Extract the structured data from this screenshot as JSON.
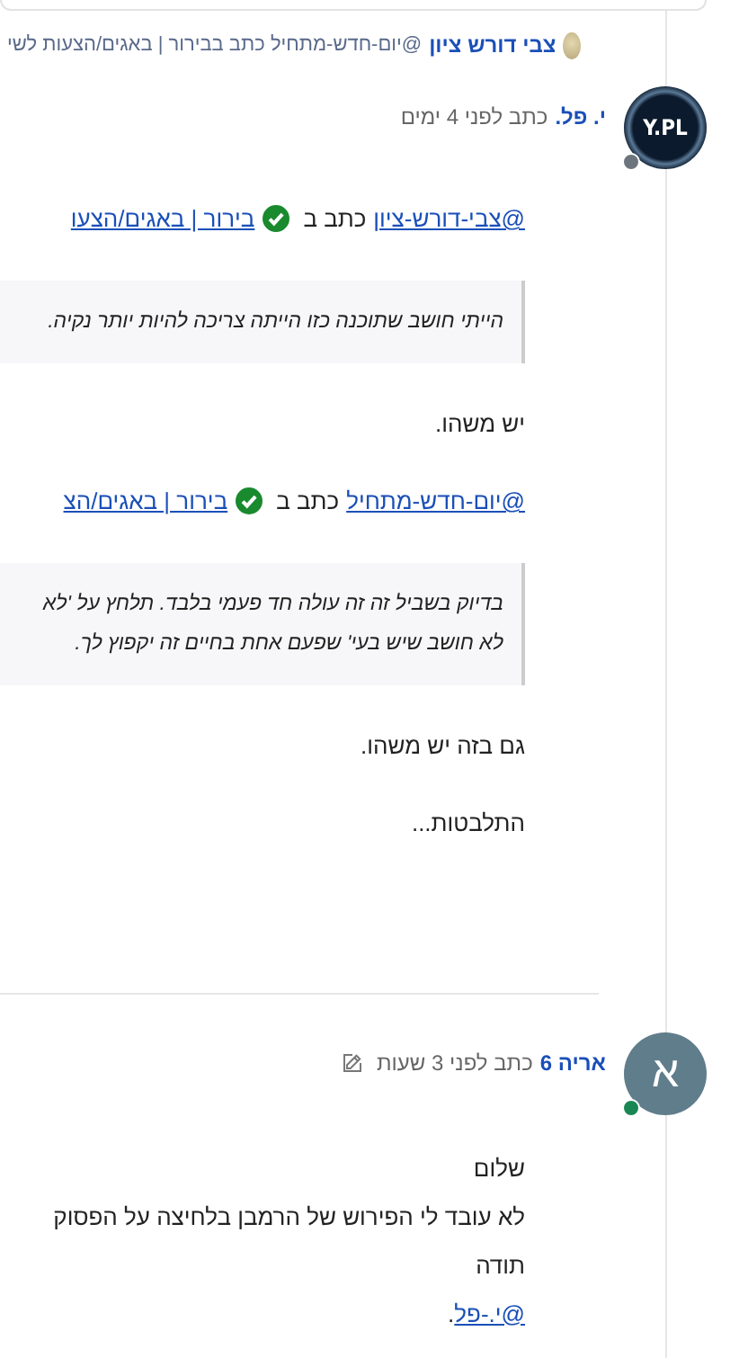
{
  "reply_context": {
    "author": "צבי דורש ציון",
    "text": "@יום-חדש-מתחיל כתב בבירור | באגים/הצעות לשי"
  },
  "posts": [
    {
      "avatar": {
        "kind": "image",
        "text": "Y.PL"
      },
      "online": false,
      "author": "י. פל.",
      "meta": "כתב לפני 4 ימים",
      "edited": false,
      "body": [
        {
          "kind": "quote_ref",
          "mention": "@צבי-דורש-ציון",
          "text": "כתב ב",
          "link": "בירור | באגים/הצעו"
        },
        {
          "kind": "blockquote",
          "lines": [
            "הייתי חושב שתוכנה כזו הייתה צריכה להיות יותר נקיה."
          ]
        },
        {
          "kind": "paragraph",
          "text": "יש משהו."
        },
        {
          "kind": "quote_ref",
          "mention": "@יום-חדש-מתחיל",
          "text": "כתב ב",
          "link": "בירור | באגים/הצ"
        },
        {
          "kind": "blockquote",
          "lines": [
            "בדיוק בשביל זה זה עולה חד פעמי בלבד. תלחץ על 'לא",
            "לא חושב שיש בעי' שפעם אחת בחיים זה יקפוץ לך."
          ]
        },
        {
          "kind": "paragraph",
          "text": "גם בזה יש משהו."
        },
        {
          "kind": "paragraph",
          "text": "התלבטות..."
        }
      ]
    },
    {
      "avatar": {
        "kind": "letter",
        "text": "א"
      },
      "online": true,
      "author": "אריה 6",
      "meta": "כתב לפני 3 שעות",
      "edited": true,
      "body": [
        {
          "kind": "lines",
          "lines": [
            "שלום",
            "לא עובד לי הפירוש של הרמבן בלחיצה על הפסוק",
            "תודה"
          ]
        },
        {
          "kind": "mention",
          "link": "@י.-פל",
          "suffix": "."
        }
      ]
    }
  ]
}
